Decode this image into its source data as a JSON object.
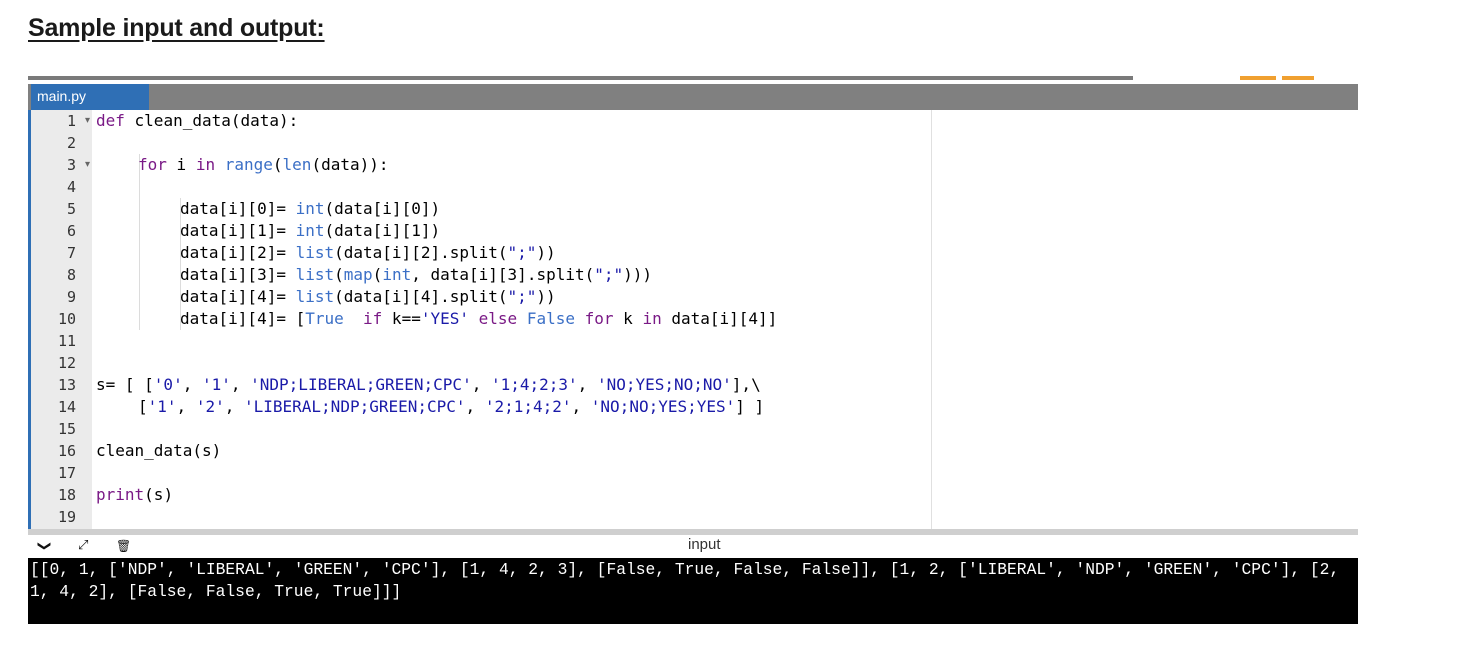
{
  "heading": "Sample input and output:",
  "tab": {
    "label": "main.py"
  },
  "line_numbers": [
    "1",
    "2",
    "3",
    "4",
    "5",
    "6",
    "7",
    "8",
    "9",
    "10",
    "11",
    "12",
    "13",
    "14",
    "15",
    "16",
    "17",
    "18",
    "19"
  ],
  "code": {
    "l1": [
      "def",
      " clean_data(data):"
    ],
    "l3": [
      "for",
      " i ",
      "in",
      " ",
      "range",
      "(",
      "len",
      "(data)):"
    ],
    "l5": [
      "data[i][0]= ",
      "int",
      "(data[i][0])"
    ],
    "l6": [
      "data[i][1]= ",
      "int",
      "(data[i][1])"
    ],
    "l7": [
      "data[i][2]= ",
      "list",
      "(data[i][2].split(",
      "\";\"",
      "))"
    ],
    "l8": [
      "data[i][3]= ",
      "list",
      "(",
      "map",
      "(",
      "int",
      ", data[i][3].split(",
      "\";\"",
      ")))"
    ],
    "l9": [
      "data[i][4]= ",
      "list",
      "(data[i][4].split(",
      "\";\"",
      "))"
    ],
    "l10": [
      "data[i][4]= [",
      "True",
      "  ",
      "if",
      " k==",
      "'YES'",
      " ",
      "else",
      " ",
      "False",
      " ",
      "for",
      " k ",
      "in",
      " data[i][4]]"
    ],
    "l13": [
      "s= [ [",
      "'0'",
      ", ",
      "'1'",
      ", ",
      "'NDP;LIBERAL;GREEN;CPC'",
      ", ",
      "'1;4;2;3'",
      ", ",
      "'NO;YES;NO;NO'",
      "],\\"
    ],
    "l14": [
      "[",
      "'1'",
      ", ",
      "'2'",
      ", ",
      "'LIBERAL;NDP;GREEN;CPC'",
      ", ",
      "'2;1;4;2'",
      ", ",
      "'NO;NO;YES;YES'",
      "] ]"
    ],
    "l16": [
      "clean_data(s)"
    ],
    "l18": [
      "print",
      "(s)"
    ]
  },
  "panel": {
    "title": "input",
    "collapse_glyph": "❯",
    "expand_glyph": "⤢",
    "clear_glyph": "🗑"
  },
  "console": {
    "output": "[[0, 1, ['NDP', 'LIBERAL', 'GREEN', 'CPC'], [1, 4, 2, 3], [False, True, False, False]], [1, 2, ['LIBERAL', 'NDP', 'GREEN', 'CPC'], [2, 1, 4, 2], [False, False, True, True]]]"
  },
  "icons": {
    "collapse": "chevron-down-icon",
    "expand": "expand-icon",
    "clear": "clear-console-icon"
  },
  "colors": {
    "tab_active": "#2f6fb5",
    "tab_bar": "#808080",
    "keyword": "#7a1a86",
    "builtin": "#3b6fc6",
    "string": "#1a1aa8",
    "console_bg": "#000000"
  }
}
